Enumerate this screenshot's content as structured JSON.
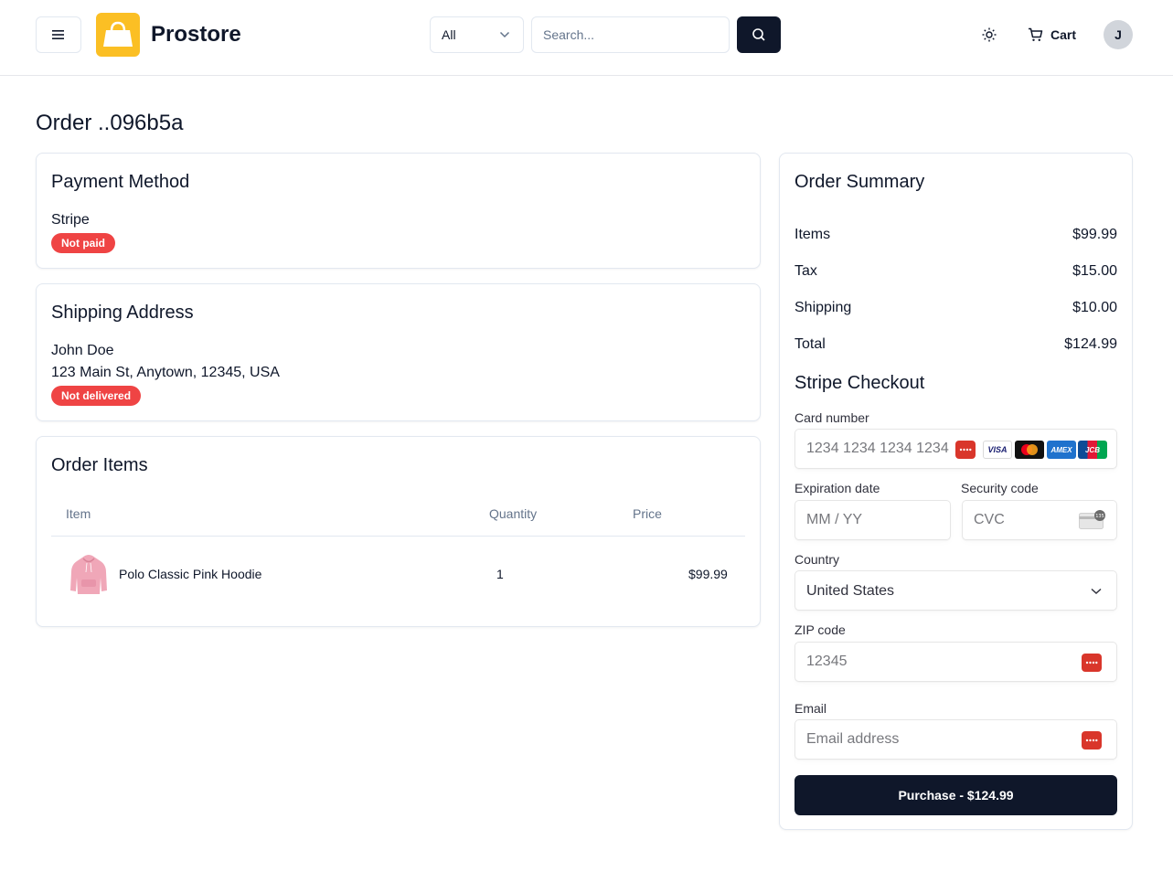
{
  "header": {
    "brand": "Prostore",
    "category_selected": "All",
    "search_placeholder": "Search...",
    "cart_label": "Cart",
    "avatar_initial": "J"
  },
  "page": {
    "title": "Order ..096b5a"
  },
  "payment": {
    "title": "Payment Method",
    "method": "Stripe",
    "status": "Not paid"
  },
  "shipping": {
    "title": "Shipping Address",
    "name": "John Doe",
    "address": "123 Main St, Anytown, 12345, USA",
    "status": "Not delivered"
  },
  "items": {
    "title": "Order Items",
    "columns": [
      "Item",
      "Quantity",
      "Price"
    ],
    "rows": [
      {
        "name": "Polo Classic Pink Hoodie",
        "quantity": "1",
        "price": "$99.99"
      }
    ]
  },
  "summary": {
    "title": "Order Summary",
    "rows": [
      {
        "label": "Items",
        "value": "$99.99"
      },
      {
        "label": "Tax",
        "value": "$15.00"
      },
      {
        "label": "Shipping",
        "value": "$10.00"
      },
      {
        "label": "Total",
        "value": "$124.99"
      }
    ]
  },
  "stripe": {
    "title": "Stripe Checkout",
    "card_number_label": "Card number",
    "card_number_placeholder": "1234 1234 1234 1234",
    "expiry_label": "Expiration date",
    "expiry_placeholder": "MM / YY",
    "cvc_label": "Security code",
    "cvc_placeholder": "CVC",
    "country_label": "Country",
    "country_value": "United States",
    "zip_label": "ZIP code",
    "zip_placeholder": "12345",
    "email_label": "Email",
    "email_placeholder": "Email address",
    "purchase_label": "Purchase - $124.99",
    "card_brands": [
      "VISA",
      "mastercard",
      "AMEX",
      "JCB"
    ]
  },
  "colors": {
    "primary": "#0f172a",
    "logo_bg": "#fbbf24",
    "badge_red": "#ef4444",
    "border": "#e2e8f0"
  }
}
